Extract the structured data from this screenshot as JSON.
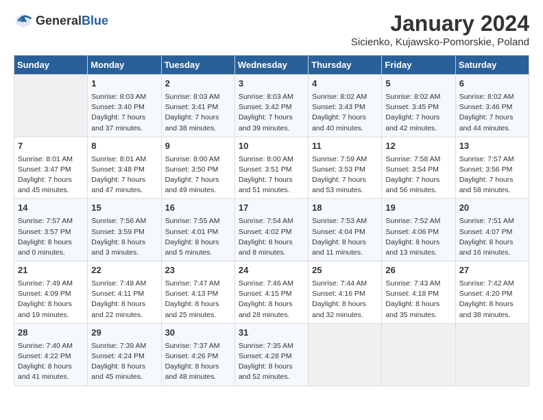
{
  "header": {
    "logo_general": "General",
    "logo_blue": "Blue",
    "title": "January 2024",
    "subtitle": "Sicienko, Kujawsko-Pomorskie, Poland"
  },
  "columns": [
    "Sunday",
    "Monday",
    "Tuesday",
    "Wednesday",
    "Thursday",
    "Friday",
    "Saturday"
  ],
  "weeks": [
    [
      {
        "day": "",
        "info": ""
      },
      {
        "day": "1",
        "info": "Sunrise: 8:03 AM\nSunset: 3:40 PM\nDaylight: 7 hours\nand 37 minutes."
      },
      {
        "day": "2",
        "info": "Sunrise: 8:03 AM\nSunset: 3:41 PM\nDaylight: 7 hours\nand 38 minutes."
      },
      {
        "day": "3",
        "info": "Sunrise: 8:03 AM\nSunset: 3:42 PM\nDaylight: 7 hours\nand 39 minutes."
      },
      {
        "day": "4",
        "info": "Sunrise: 8:02 AM\nSunset: 3:43 PM\nDaylight: 7 hours\nand 40 minutes."
      },
      {
        "day": "5",
        "info": "Sunrise: 8:02 AM\nSunset: 3:45 PM\nDaylight: 7 hours\nand 42 minutes."
      },
      {
        "day": "6",
        "info": "Sunrise: 8:02 AM\nSunset: 3:46 PM\nDaylight: 7 hours\nand 44 minutes."
      }
    ],
    [
      {
        "day": "7",
        "info": "Sunrise: 8:01 AM\nSunset: 3:47 PM\nDaylight: 7 hours\nand 45 minutes."
      },
      {
        "day": "8",
        "info": "Sunrise: 8:01 AM\nSunset: 3:48 PM\nDaylight: 7 hours\nand 47 minutes."
      },
      {
        "day": "9",
        "info": "Sunrise: 8:00 AM\nSunset: 3:50 PM\nDaylight: 7 hours\nand 49 minutes."
      },
      {
        "day": "10",
        "info": "Sunrise: 8:00 AM\nSunset: 3:51 PM\nDaylight: 7 hours\nand 51 minutes."
      },
      {
        "day": "11",
        "info": "Sunrise: 7:59 AM\nSunset: 3:53 PM\nDaylight: 7 hours\nand 53 minutes."
      },
      {
        "day": "12",
        "info": "Sunrise: 7:58 AM\nSunset: 3:54 PM\nDaylight: 7 hours\nand 56 minutes."
      },
      {
        "day": "13",
        "info": "Sunrise: 7:57 AM\nSunset: 3:56 PM\nDaylight: 7 hours\nand 58 minutes."
      }
    ],
    [
      {
        "day": "14",
        "info": "Sunrise: 7:57 AM\nSunset: 3:57 PM\nDaylight: 8 hours\nand 0 minutes."
      },
      {
        "day": "15",
        "info": "Sunrise: 7:56 AM\nSunset: 3:59 PM\nDaylight: 8 hours\nand 3 minutes."
      },
      {
        "day": "16",
        "info": "Sunrise: 7:55 AM\nSunset: 4:01 PM\nDaylight: 8 hours\nand 5 minutes."
      },
      {
        "day": "17",
        "info": "Sunrise: 7:54 AM\nSunset: 4:02 PM\nDaylight: 8 hours\nand 8 minutes."
      },
      {
        "day": "18",
        "info": "Sunrise: 7:53 AM\nSunset: 4:04 PM\nDaylight: 8 hours\nand 11 minutes."
      },
      {
        "day": "19",
        "info": "Sunrise: 7:52 AM\nSunset: 4:06 PM\nDaylight: 8 hours\nand 13 minutes."
      },
      {
        "day": "20",
        "info": "Sunrise: 7:51 AM\nSunset: 4:07 PM\nDaylight: 8 hours\nand 16 minutes."
      }
    ],
    [
      {
        "day": "21",
        "info": "Sunrise: 7:49 AM\nSunset: 4:09 PM\nDaylight: 8 hours\nand 19 minutes."
      },
      {
        "day": "22",
        "info": "Sunrise: 7:48 AM\nSunset: 4:11 PM\nDaylight: 8 hours\nand 22 minutes."
      },
      {
        "day": "23",
        "info": "Sunrise: 7:47 AM\nSunset: 4:13 PM\nDaylight: 8 hours\nand 25 minutes."
      },
      {
        "day": "24",
        "info": "Sunrise: 7:46 AM\nSunset: 4:15 PM\nDaylight: 8 hours\nand 28 minutes."
      },
      {
        "day": "25",
        "info": "Sunrise: 7:44 AM\nSunset: 4:16 PM\nDaylight: 8 hours\nand 32 minutes."
      },
      {
        "day": "26",
        "info": "Sunrise: 7:43 AM\nSunset: 4:18 PM\nDaylight: 8 hours\nand 35 minutes."
      },
      {
        "day": "27",
        "info": "Sunrise: 7:42 AM\nSunset: 4:20 PM\nDaylight: 8 hours\nand 38 minutes."
      }
    ],
    [
      {
        "day": "28",
        "info": "Sunrise: 7:40 AM\nSunset: 4:22 PM\nDaylight: 8 hours\nand 41 minutes."
      },
      {
        "day": "29",
        "info": "Sunrise: 7:39 AM\nSunset: 4:24 PM\nDaylight: 8 hours\nand 45 minutes."
      },
      {
        "day": "30",
        "info": "Sunrise: 7:37 AM\nSunset: 4:26 PM\nDaylight: 8 hours\nand 48 minutes."
      },
      {
        "day": "31",
        "info": "Sunrise: 7:35 AM\nSunset: 4:28 PM\nDaylight: 8 hours\nand 52 minutes."
      },
      {
        "day": "",
        "info": ""
      },
      {
        "day": "",
        "info": ""
      },
      {
        "day": "",
        "info": ""
      }
    ]
  ]
}
